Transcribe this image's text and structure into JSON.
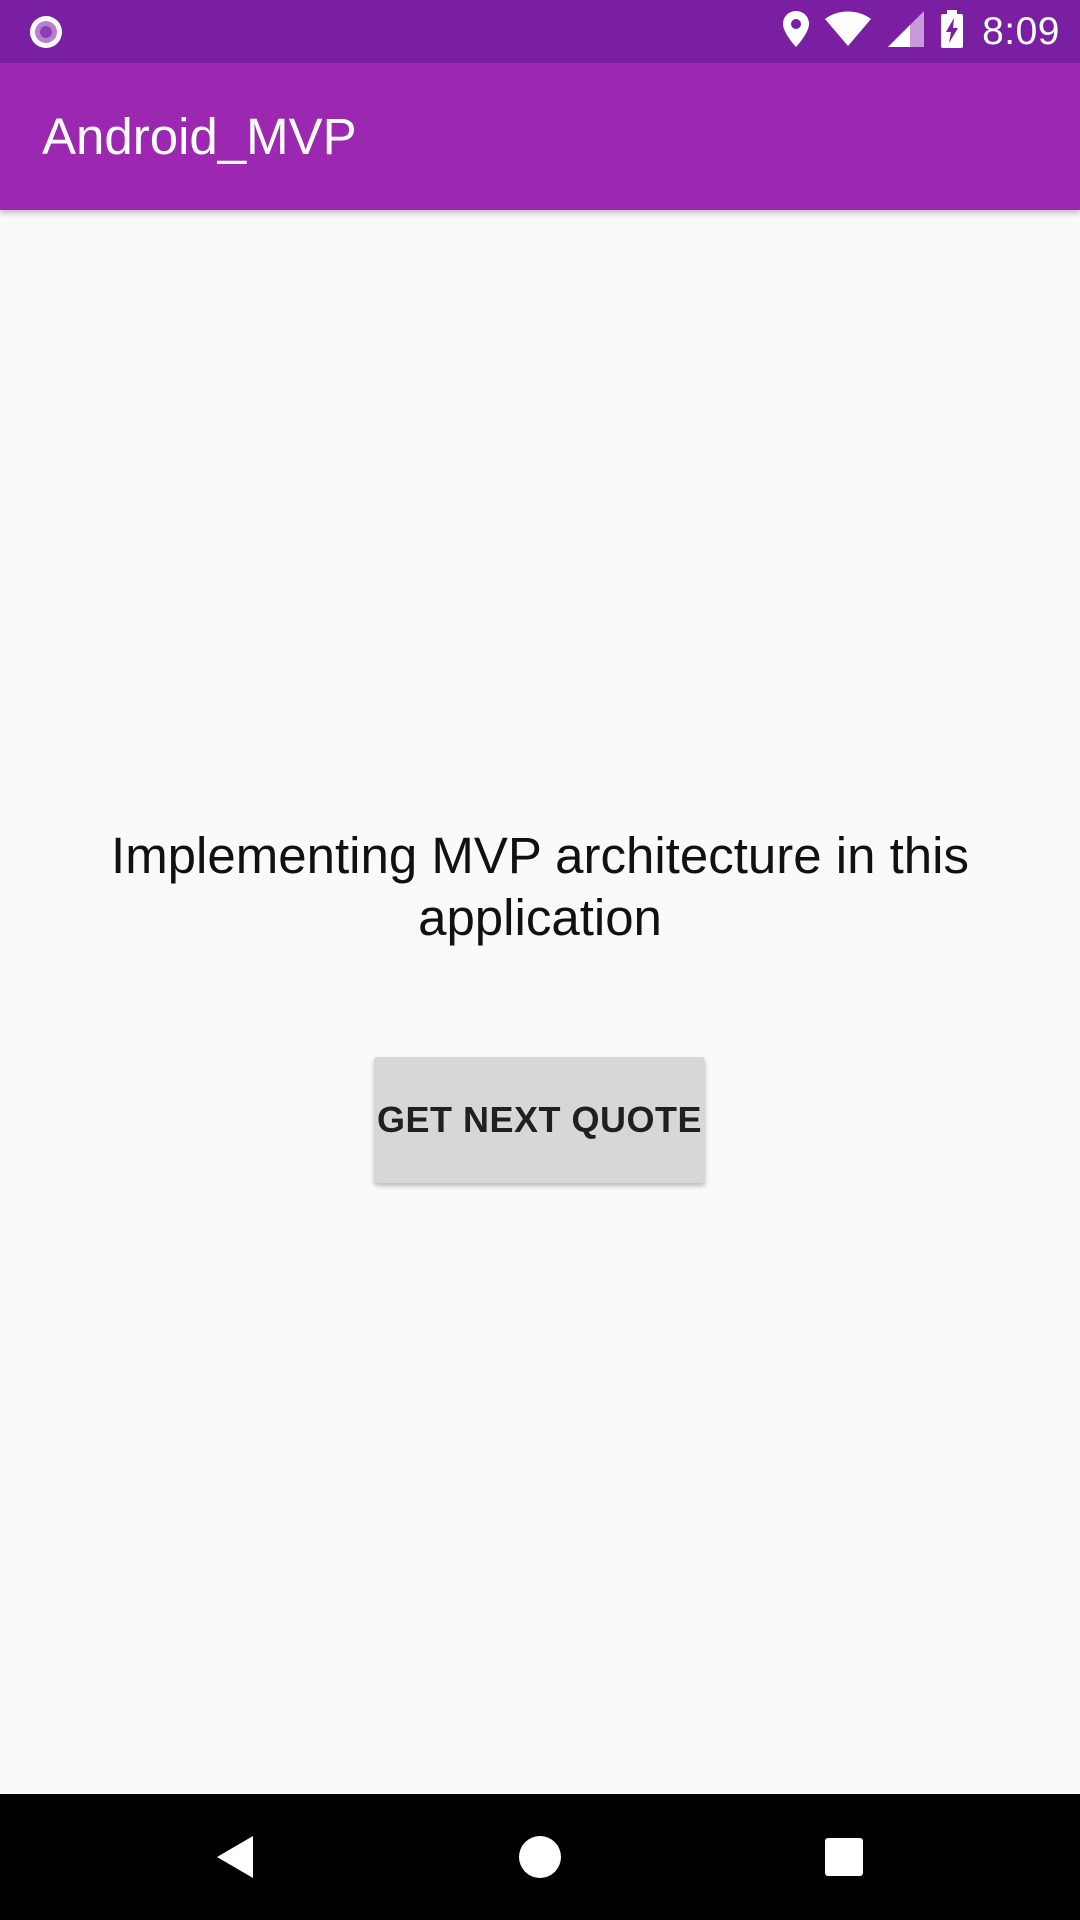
{
  "status_bar": {
    "time": "8:09",
    "icons": [
      "notification-dot-icon",
      "location-icon",
      "wifi-icon",
      "signal-icon",
      "battery-charging-icon"
    ],
    "background_color": "#7b1fa2"
  },
  "app_bar": {
    "title": "Android_MVP",
    "background_color": "#9c27b0"
  },
  "main": {
    "message": "Implementing MVP architecture in this application",
    "next_button_label": "GET NEXT QUOTE"
  },
  "nav_bar": {
    "icons": [
      "back-icon",
      "home-icon",
      "recents-icon"
    ]
  }
}
